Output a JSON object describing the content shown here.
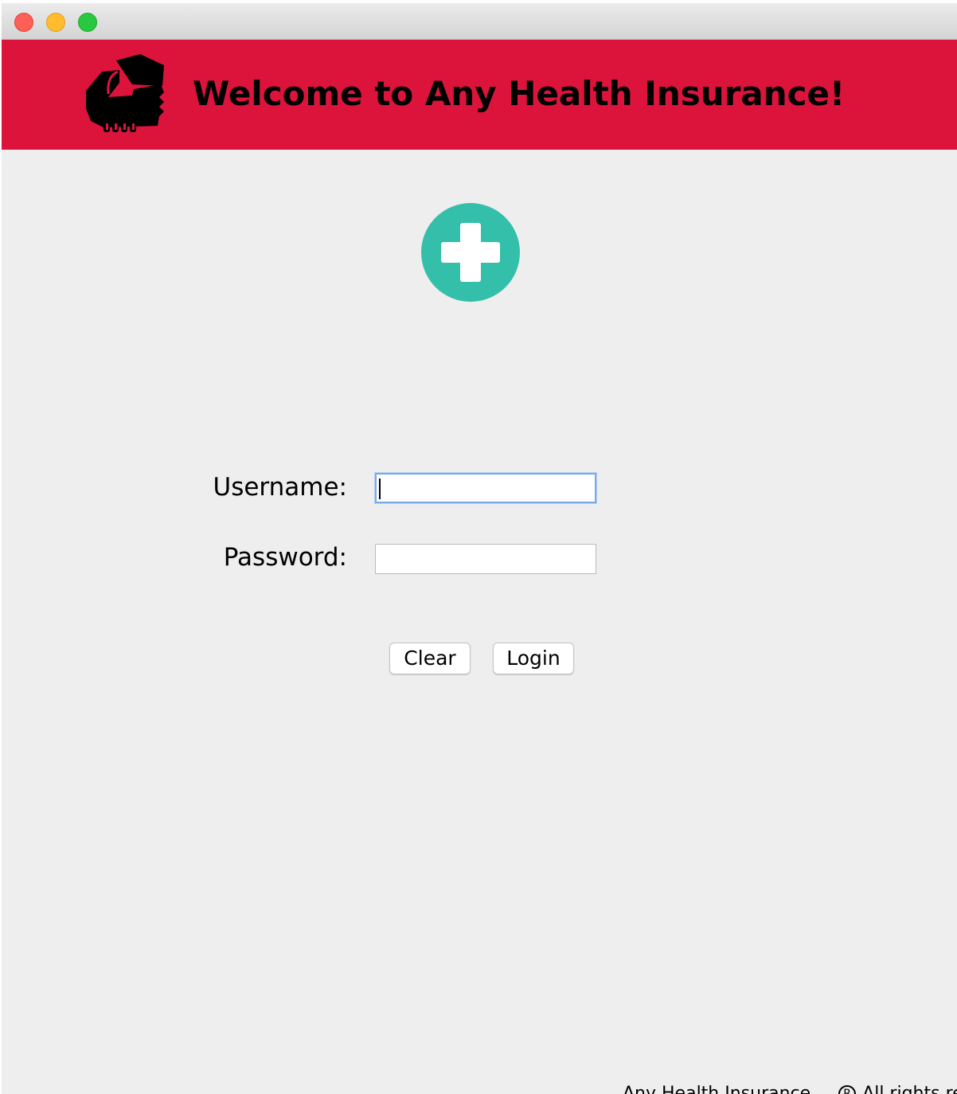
{
  "window": {
    "controls": [
      "close",
      "minimize",
      "zoom"
    ]
  },
  "banner": {
    "title": "Welcome to Any Health Insurance!",
    "logo_icon": "hand-holding-card-icon",
    "background_color": "#dc143c"
  },
  "hero": {
    "icon": "medical-cross-icon",
    "icon_color": "#33bfaa"
  },
  "login_form": {
    "username_label": "Username:",
    "username_value": "",
    "password_label": "Password:",
    "password_value": "",
    "clear_label": "Clear",
    "login_label": "Login"
  },
  "footer": {
    "company_text": "Any Health Insurance",
    "rights_text": "All rights reserved."
  }
}
